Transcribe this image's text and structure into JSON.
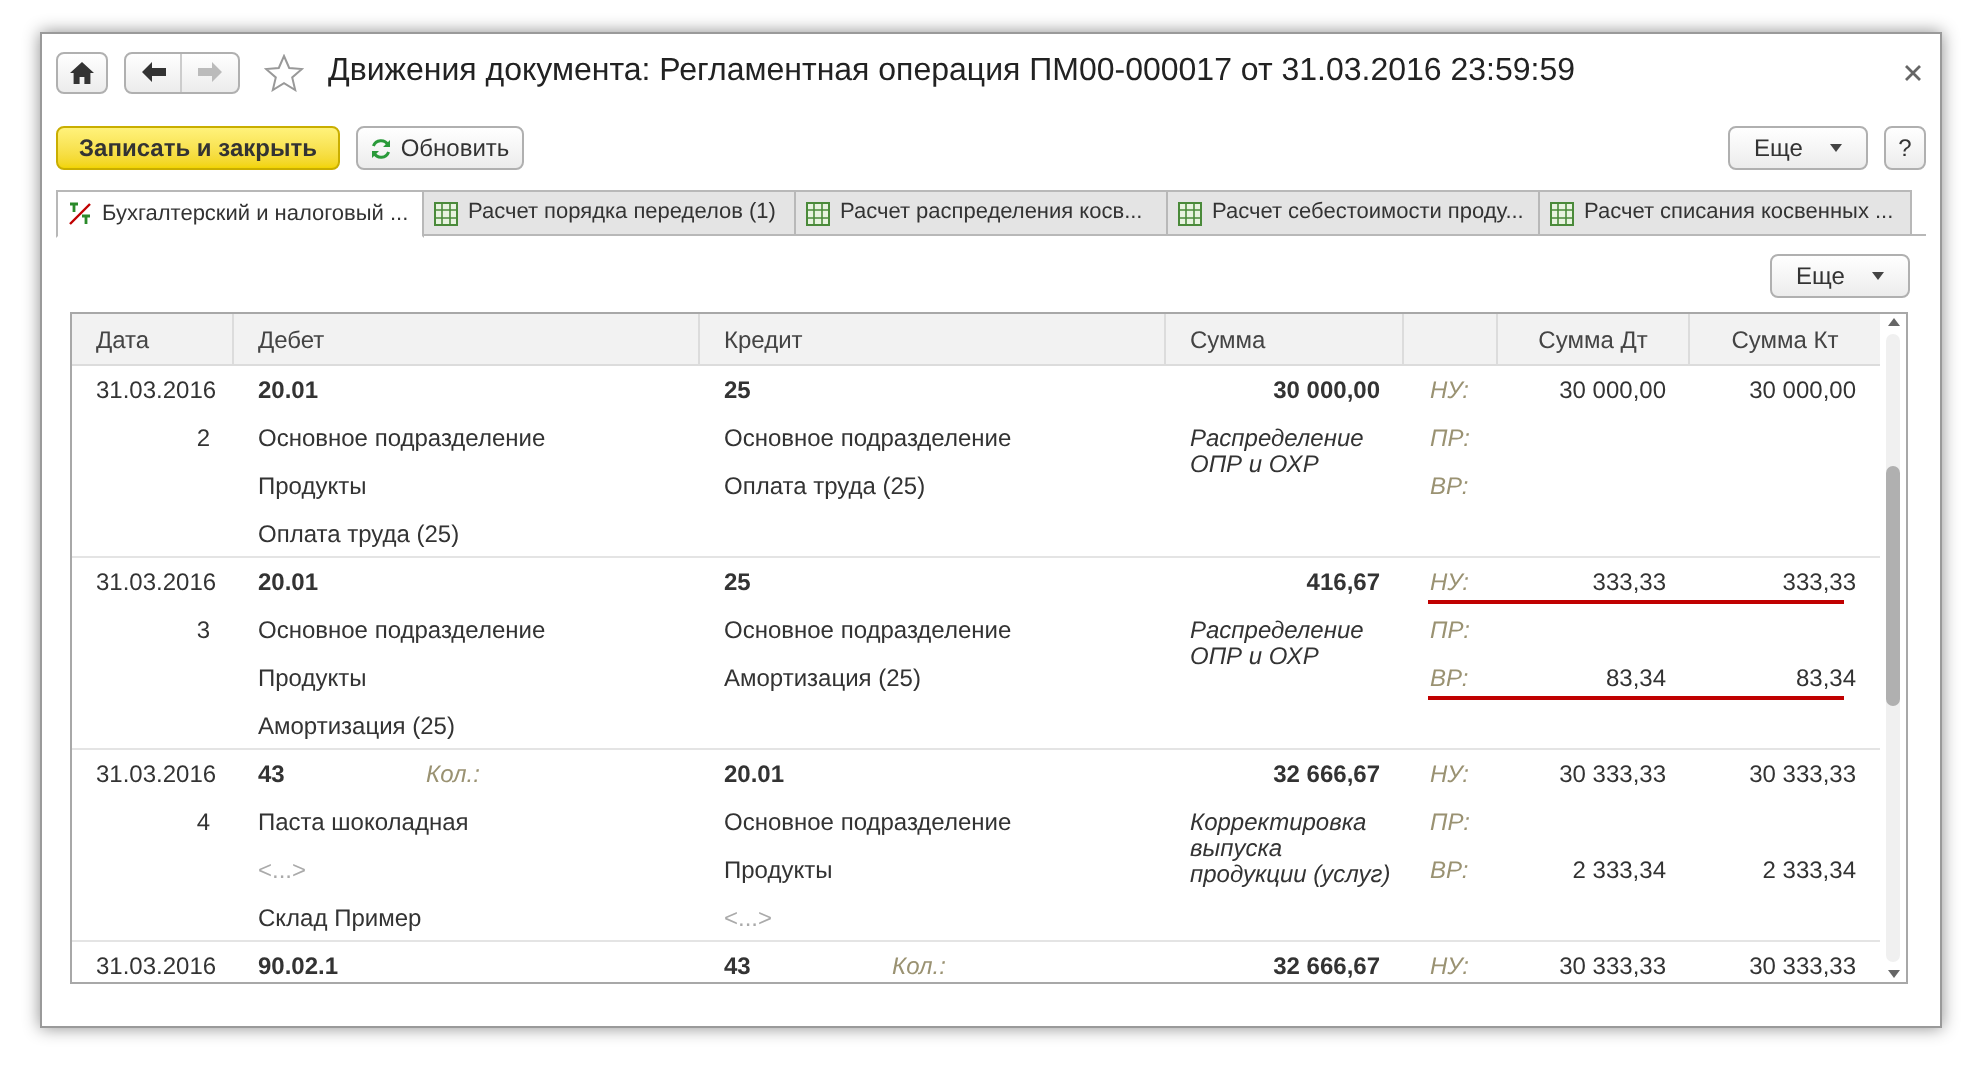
{
  "window": {
    "title": "Движения документа: Регламентная операция ПМ00-000017 от 31.03.2016 23:59:59",
    "favorite": false
  },
  "toolbar": {
    "save_close": "Записать и закрыть",
    "refresh": "Обновить",
    "more": "Еще",
    "help": "?"
  },
  "tabs": [
    {
      "label": "Бухгалтерский и налоговый ...",
      "kind": "ledger",
      "selected": true
    },
    {
      "label": "Расчет порядка переделов (1)",
      "kind": "table",
      "selected": false
    },
    {
      "label": "Расчет распределения косв...",
      "kind": "table",
      "selected": false
    },
    {
      "label": "Расчет себестоимости проду...",
      "kind": "table",
      "selected": false
    },
    {
      "label": "Расчет списания косвенных ...",
      "kind": "table",
      "selected": false
    }
  ],
  "tab_more": "Еще",
  "table": {
    "columns": [
      "Дата",
      "Дебет",
      "Кредит",
      "Сумма",
      "Сумма Дт",
      "Сумма Кт"
    ],
    "rows": [
      {
        "date": "31.03.2016",
        "number": "2",
        "debit": {
          "account": "20.01",
          "lines": [
            {
              "text": "Основное подразделение",
              "empty": false
            },
            {
              "text": "Продукты",
              "empty": false
            },
            {
              "text": "Оплата труда (25)",
              "empty": false
            }
          ]
        },
        "credit": {
          "account": "25",
          "lines": [
            {
              "text": "Основное подразделение",
              "empty": false
            },
            {
              "text": "Оплата труда (25)",
              "empty": false
            }
          ]
        },
        "amount": "30 000,00",
        "content": "Распределение ОПР и ОХР",
        "registers": [
          {
            "label": "НУ:",
            "dt": "30 000,00",
            "kt": "30 000,00",
            "underlined": false
          },
          {
            "label": "ПР:",
            "underlined": false
          },
          {
            "label": "ВР:",
            "underlined": false
          }
        ]
      },
      {
        "date": "31.03.2016",
        "number": "3",
        "debit": {
          "account": "20.01",
          "lines": [
            {
              "text": "Основное подразделение",
              "empty": false
            },
            {
              "text": "Продукты",
              "empty": false
            },
            {
              "text": "Амортизация (25)",
              "empty": false
            }
          ]
        },
        "credit": {
          "account": "25",
          "lines": [
            {
              "text": "Основное подразделение",
              "empty": false
            },
            {
              "text": "Амортизация (25)",
              "empty": false
            }
          ]
        },
        "amount": "416,67",
        "content": "Распределение ОПР и ОХР",
        "registers": [
          {
            "label": "НУ:",
            "dt": "333,33",
            "kt": "333,33",
            "underlined": true
          },
          {
            "label": "ПР:",
            "underlined": false
          },
          {
            "label": "ВР:",
            "dt": "83,34",
            "kt": "83,34",
            "underlined": true
          }
        ]
      },
      {
        "date": "31.03.2016",
        "number": "4",
        "debit": {
          "account": "43",
          "qty": "Кол.:",
          "lines": [
            {
              "text": "Паста шоколадная",
              "empty": false
            },
            {
              "text": "<...>",
              "empty": true
            },
            {
              "text": "Склад Пример",
              "empty": false
            }
          ]
        },
        "credit": {
          "account": "20.01",
          "lines": [
            {
              "text": "Основное подразделение",
              "empty": false
            },
            {
              "text": "Продукты",
              "empty": false
            },
            {
              "text": "<...>",
              "empty": true
            }
          ]
        },
        "amount": "32 666,67",
        "content": "Корректировка выпуска продукции (услуг)",
        "registers": [
          {
            "label": "НУ:",
            "dt": "30 333,33",
            "kt": "30 333,33",
            "underlined": false
          },
          {
            "label": "ПР:",
            "underlined": false
          },
          {
            "label": "ВР:",
            "dt": "2 333,34",
            "kt": "2 333,34",
            "underlined": false
          }
        ]
      },
      {
        "date": "31.03.2016",
        "debit": {
          "account": "90.02.1"
        },
        "credit": {
          "account": "43",
          "qty": "Кол.:"
        },
        "amount": "32 666,67",
        "registers": [
          {
            "label": "НУ:",
            "dt": "30 333,33",
            "kt": "30 333,33"
          }
        ]
      }
    ]
  }
}
